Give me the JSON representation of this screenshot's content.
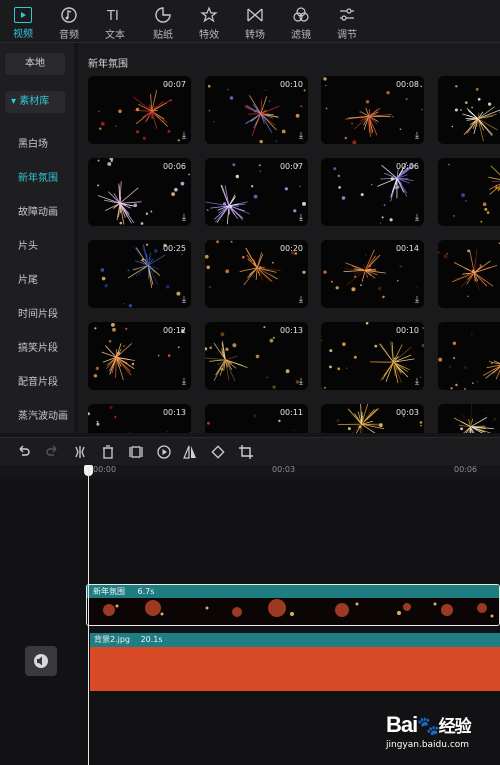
{
  "toolbar": {
    "tabs": [
      {
        "label": "视频",
        "icon": "video-icon",
        "active": true
      },
      {
        "label": "音频",
        "icon": "music-note-icon"
      },
      {
        "label": "文本",
        "icon": "text-icon"
      },
      {
        "label": "贴纸",
        "icon": "sticker-icon"
      },
      {
        "label": "特效",
        "icon": "effects-star-icon"
      },
      {
        "label": "转场",
        "icon": "transition-icon"
      },
      {
        "label": "滤镜",
        "icon": "filter-icon"
      },
      {
        "label": "调节",
        "icon": "adjust-sliders-icon"
      }
    ]
  },
  "sidebar": {
    "local_label": "本地",
    "library_label": "▾ 素材库",
    "items": [
      "黑白场",
      "新年氛围",
      "故障动画",
      "片头",
      "片尾",
      "时间片段",
      "搞笑片段",
      "配音片段",
      "蒸汽波动画"
    ],
    "active_index": 1
  },
  "main": {
    "section_title": "新年氛围",
    "durations": [
      [
        "00:07",
        "00:10",
        "00:08",
        ""
      ],
      [
        "00:06",
        "00:07",
        "00:06",
        ""
      ],
      [
        "00:25",
        "00:20",
        "00:14",
        ""
      ],
      [
        "00:12",
        "00:13",
        "00:10",
        ""
      ],
      [
        "00:13",
        "00:11",
        "00:03",
        ""
      ]
    ],
    "download_glyph": "⤓"
  },
  "ruler": {
    "t0": "00:00",
    "t1": "00:03",
    "t2": "00:06"
  },
  "timeline": {
    "clip1_name": "新年氛围",
    "clip1_duration": "6.7s",
    "clip2_name": "背景2.jpg",
    "clip2_duration": "20.1s"
  },
  "watermark": {
    "brand": "Bai",
    "brand2": "经验",
    "url": "jingyan.baidu.com"
  },
  "colors": {
    "accent": "#2ec9d5",
    "clip_header": "#1e7d80",
    "bg_clip": "#d94a26"
  }
}
